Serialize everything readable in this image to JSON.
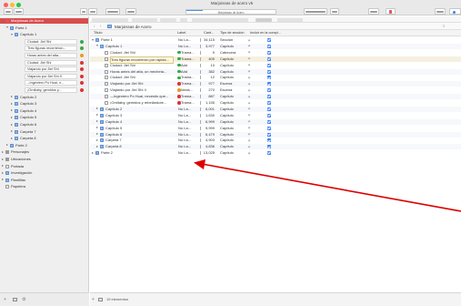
{
  "window": {
    "title": "Marjoissas de acero v5",
    "progress_text": "Marjoissas de Acero",
    "progress": 0.18
  },
  "sidebar": {
    "rows": [
      {
        "indent": 0,
        "twisty": "open",
        "icon": "red",
        "label": "Marjoissas de Acero",
        "selected": true
      },
      {
        "indent": 1,
        "twisty": "open",
        "icon": "folder",
        "label": "Parte 1"
      },
      {
        "indent": 2,
        "twisty": "open",
        "icon": "folder",
        "label": "Capítulo 1"
      },
      {
        "indent": 3,
        "card": true,
        "label": "Ciudad: Jiel Shi",
        "dot": "#33aa44"
      },
      {
        "indent": 3,
        "card": true,
        "label": "Tres figuras recorrieron...",
        "dot": "#33aa44"
      },
      {
        "indent": 3,
        "card": true,
        "label": "Horas antes del atta...",
        "dot": "#ee9922"
      },
      {
        "indent": 3,
        "card": true,
        "label": "Ciudad: Jiel Shi",
        "dot": "#dd3333"
      },
      {
        "indent": 3,
        "card": true,
        "label": "Viajando por Jiel Shi",
        "dot": "#dd3333"
      },
      {
        "indent": 3,
        "card": true,
        "label": "Viajando por Jiel Shi II",
        "dot": "#dd3333"
      },
      {
        "indent": 3,
        "card": true,
        "label": "--Ingeniero Po Huai, n...",
        "dot": "#dd3333"
      },
      {
        "indent": 3,
        "card": true,
        "label": "¡Ornitaby, gemidos y...",
        "dot": "#dd3333"
      },
      {
        "indent": 2,
        "twisty": "closed",
        "icon": "folder",
        "label": "Capítulo 2"
      },
      {
        "indent": 2,
        "twisty": "closed",
        "icon": "folder",
        "label": "Capítulo 3"
      },
      {
        "indent": 2,
        "twisty": "closed",
        "icon": "folder",
        "label": "Capítulo 4"
      },
      {
        "indent": 2,
        "twisty": "closed",
        "icon": "folder",
        "label": "Capítulo 5"
      },
      {
        "indent": 2,
        "twisty": "closed",
        "icon": "folder",
        "label": "Capítulo 6"
      },
      {
        "indent": 2,
        "twisty": "closed",
        "icon": "folder",
        "label": "Carpeta 7"
      },
      {
        "indent": 2,
        "twisty": "closed",
        "icon": "folder",
        "label": "Carpeta 8"
      },
      {
        "indent": 1,
        "twisty": "closed",
        "icon": "folder",
        "label": "Parte 2"
      },
      {
        "indent": 0,
        "twisty": "closed",
        "icon": "grey",
        "label": "Personajes"
      },
      {
        "indent": 0,
        "twisty": "closed",
        "icon": "grey",
        "label": "Ubicaciones"
      },
      {
        "indent": 0,
        "twisty": "closed",
        "icon": "doc",
        "label": "Portada"
      },
      {
        "indent": 0,
        "twisty": "closed",
        "icon": "folder",
        "label": "Investigación"
      },
      {
        "indent": 0,
        "twisty": "closed",
        "icon": "folder",
        "label": "Plantillas"
      },
      {
        "indent": 0,
        "twisty": "",
        "icon": "doc",
        "label": "Papelera"
      }
    ]
  },
  "editor": {
    "header_title": "Marjoissas de Acero",
    "columns": {
      "title": "Título",
      "label": "Label",
      "words": "Cant...",
      "type": "Tipo de sección",
      "include": "Incluir en la compi..."
    },
    "rows": [
      {
        "indent": 0,
        "twisty": "open",
        "icon": "folder",
        "title": "Parte 1",
        "dot": "",
        "label": "No La...",
        "words": "34,115",
        "type": "Sección"
      },
      {
        "indent": 1,
        "twisty": "open",
        "icon": "folder",
        "title": "Capítulo 1",
        "dot": "",
        "label": "No La...",
        "words": "3,977",
        "type": "Capítulo"
      },
      {
        "indent": 2,
        "twisty": "",
        "icon": "doc",
        "title": "Ciudad: Jiel Shi",
        "dot": "#33aa44",
        "label": "Trama...",
        "words": "9",
        "type": "Cabecera"
      },
      {
        "indent": 2,
        "twisty": "",
        "icon": "doc",
        "title": "Tres figuras recorrieron por rapida...",
        "dot": "#33aa44",
        "label": "Trama...",
        "words": "409",
        "type": "Capítulo",
        "hl": true
      },
      {
        "indent": 2,
        "twisty": "",
        "icon": "doc",
        "title": "Ciudad: Jiel Shi",
        "dot": "#33aa44",
        "label": "Add",
        "words": "10",
        "type": "Capítulo"
      },
      {
        "indent": 2,
        "twisty": "",
        "icon": "doc",
        "title": "Horas antes del atta, un mecheta...",
        "dot": "#33aa44",
        "label": "Add",
        "words": "382",
        "type": "Capítulo"
      },
      {
        "indent": 2,
        "twisty": "",
        "icon": "doc",
        "title": "Ciudad: Jiel Shi",
        "dot": "#33aa44",
        "label": "Trama...",
        "words": "12",
        "type": "Capítulo"
      },
      {
        "indent": 2,
        "twisty": "",
        "icon": "doc",
        "title": "Viajando por Jiel Shi",
        "dot": "#dd3333",
        "label": "Trama...",
        "words": "977",
        "type": "Escena"
      },
      {
        "indent": 2,
        "twisty": "",
        "icon": "doc",
        "title": "Viajando por Jiel Shi II",
        "dot": "#ee9922",
        "label": "Ideas...",
        "words": "270",
        "type": "Escena"
      },
      {
        "indent": 2,
        "twisty": "",
        "icon": "doc",
        "title": "—Ingeniero Po Huai, necesito que...",
        "dot": "#dd3333",
        "label": "Trama...",
        "words": "887",
        "type": "Capítulo"
      },
      {
        "indent": 2,
        "twisty": "",
        "icon": "doc",
        "title": "¡Ornitaby, gemidos y rebelándote...",
        "dot": "#dd3333",
        "label": "Trama...",
        "words": "1,155",
        "type": "Capítulo"
      },
      {
        "indent": 1,
        "twisty": "closed",
        "icon": "folder",
        "title": "Capítulo 2",
        "dot": "",
        "label": "No La...",
        "words": "6,001",
        "type": "Capítulo"
      },
      {
        "indent": 1,
        "twisty": "closed",
        "icon": "folder",
        "title": "Capítulo 3",
        "dot": "",
        "label": "No La...",
        "words": "1,630",
        "type": "Capítulo"
      },
      {
        "indent": 1,
        "twisty": "closed",
        "icon": "folder",
        "title": "Capítulo 4",
        "dot": "",
        "label": "No La...",
        "words": "6,999",
        "type": "Capítulo"
      },
      {
        "indent": 1,
        "twisty": "closed",
        "icon": "folder",
        "title": "Capítulo 5",
        "dot": "",
        "label": "No La...",
        "words": "5,999",
        "type": "Capítulo"
      },
      {
        "indent": 1,
        "twisty": "closed",
        "icon": "folder",
        "title": "Capítulo 6",
        "dot": "",
        "label": "No La...",
        "words": "6,479",
        "type": "Capítulo"
      },
      {
        "indent": 1,
        "twisty": "closed",
        "icon": "folder",
        "title": "Carpeta 7",
        "dot": "",
        "label": "No La...",
        "words": "4,903",
        "type": "Capítulo"
      },
      {
        "indent": 1,
        "twisty": "closed",
        "icon": "folder",
        "title": "Carpeta 8",
        "dot": "",
        "label": "No La...",
        "words": "4,836",
        "type": "Capítulo"
      },
      {
        "indent": 0,
        "twisty": "closed",
        "icon": "folder",
        "title": "Parte 2",
        "dot": "",
        "label": "No La...",
        "words": "13,025",
        "type": "Capítulo"
      }
    ]
  },
  "bottom": {
    "items_count": "19 elementos"
  },
  "colors": {
    "selection": "#d94d4d",
    "checkbox": "#3b82f6",
    "annotation": "#dd0000"
  }
}
